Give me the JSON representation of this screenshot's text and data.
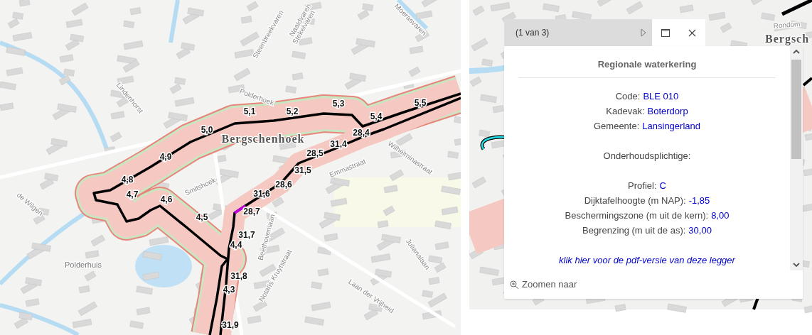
{
  "left_map": {
    "place_labels": [
      {
        "text": "Bergschenhoek",
        "kind": "town"
      },
      {
        "text": "Polderhuis",
        "kind": "place"
      },
      {
        "text": "Smitshoek",
        "kind": "street"
      },
      {
        "text": "Lindenhorst",
        "kind": "street"
      },
      {
        "text": "Emmastraat",
        "kind": "street"
      },
      {
        "text": "Wilhelminastraat",
        "kind": "street"
      },
      {
        "text": "Beethovenlaan",
        "kind": "street"
      },
      {
        "text": "de Wilgen",
        "kind": "street"
      },
      {
        "text": "Notaris Kruytstraat",
        "kind": "street"
      },
      {
        "text": "Laan der Vrijheid",
        "kind": "street"
      },
      {
        "text": "Julianalaan",
        "kind": "street"
      },
      {
        "text": "Steenbreekvaren",
        "kind": "street"
      },
      {
        "text": "Stekelvaren",
        "kind": "street"
      },
      {
        "text": "Naaldvaren",
        "kind": "street"
      },
      {
        "text": "Moerasvaren",
        "kind": "street"
      },
      {
        "text": "Polderhoek",
        "kind": "street"
      }
    ],
    "chainage_labels": [
      "5,1",
      "5,2",
      "5,3",
      "5,4",
      "5,5",
      "5,0",
      "4,9",
      "4,8",
      "4,7",
      "4,6",
      "4,5",
      "28,4",
      "31,4",
      "28,5",
      "31,5",
      "28,6",
      "31,6",
      "28,7",
      "31,7",
      "4,4",
      "31,8",
      "4,3",
      "31,9"
    ]
  },
  "right_map": {
    "place_labels": [
      {
        "text": "Rondom",
        "kind": "street"
      },
      {
        "text": "Bergsch",
        "kind": "town"
      }
    ]
  },
  "popup": {
    "pager": "(1 van 3)",
    "title": "Regionale waterkering",
    "field_groups": [
      [
        {
          "label": "Code:",
          "value": "BLE 010"
        },
        {
          "label": "Kadevak:",
          "value": "Boterdorp"
        },
        {
          "label": "Gemeente:",
          "value": "Lansingerland"
        }
      ],
      [
        {
          "label": "Onderhoudsplichtige:"
        }
      ],
      [
        {
          "label": "Profiel:",
          "value": "C"
        },
        {
          "label": "Dijktafelhoogte (m NAP):",
          "value": "-1,85"
        },
        {
          "label": "Beschermingszone (m uit de kern):",
          "value": "8,00"
        },
        {
          "label": "Begrenzing (m uit de as):",
          "value": "30,00"
        }
      ]
    ],
    "link": "klik hier voor de pdf-versie van deze legger",
    "zoom_action": "Zoomen naar"
  }
}
